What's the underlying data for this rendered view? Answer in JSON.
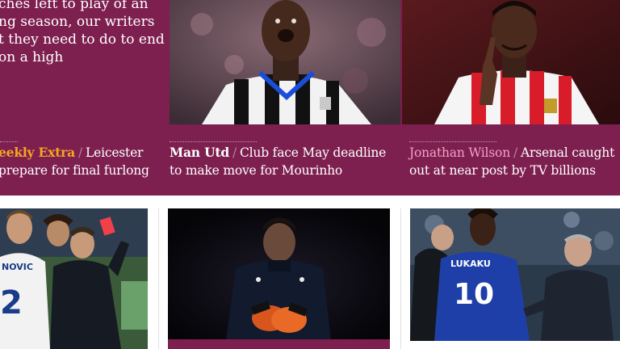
{
  "colors": {
    "band": "#7d1f4f",
    "highlight_orange": "#f5a623",
    "highlight_pink": "#f3a1c6",
    "text": "#ffffff"
  },
  "intro": {
    "lines": [
      "ches left to play of an",
      "ng season, our writers",
      "t they need to do to end",
      "on a high"
    ]
  },
  "cards": [
    {
      "kicker": "eekly Extra",
      "separator": "/",
      "line1": "Leicester",
      "line2": "prepare for final furlong",
      "kicker_color": "#f5a623"
    },
    {
      "kicker": "Man Utd",
      "separator": "/",
      "line1": "Club face May deadline",
      "line2": "to make move for Mourinho",
      "kicker_color": "#ffffff"
    },
    {
      "kicker": "Jonathan Wilson",
      "separator": "/",
      "line1": "Arsenal caught",
      "line2": "out at near post by TV billions",
      "kicker_color": "#f3a1c6"
    }
  ],
  "photos": {
    "newcastle_player": {
      "shirt_text": ""
    },
    "sunderland_player": {
      "shirt_text": ""
    },
    "chelsea_red_card": {
      "shirt_name": "NOVIC",
      "shirt_number": "2"
    },
    "spurs_keeper": {
      "shirt_text": ""
    },
    "everton_player": {
      "shirt_name": "LUKAKU",
      "shirt_number": "10"
    }
  }
}
